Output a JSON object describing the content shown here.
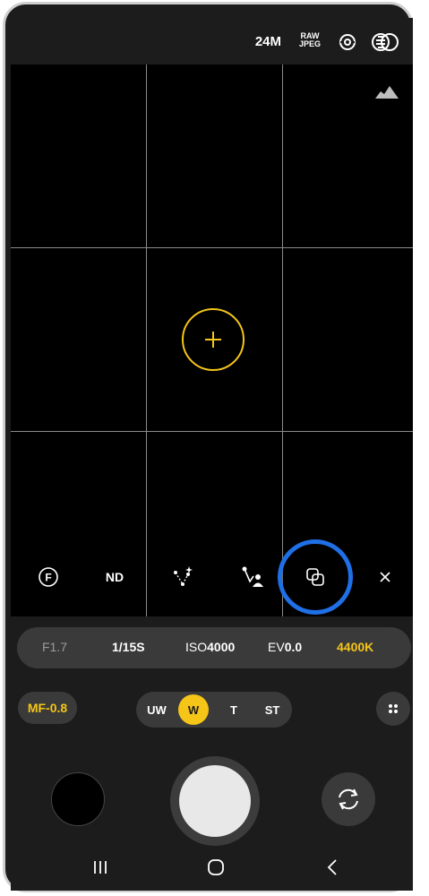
{
  "status_bar": {
    "resolution_label": "24M",
    "format_label_top": "RAW",
    "format_label_bottom": "JPEG",
    "icons": [
      "focus-ring-icon",
      "overlap-circles-icon"
    ]
  },
  "viewfinder": {
    "histogram_icon": "mountain-icon",
    "focus_point": "plus-target"
  },
  "tools": [
    {
      "name": "f-icon"
    },
    {
      "name": "nd-filter",
      "label": "ND"
    },
    {
      "name": "astro-icon"
    },
    {
      "name": "curve-person-icon"
    },
    {
      "name": "multi-exposure-icon"
    },
    {
      "name": "close-icon"
    }
  ],
  "params": {
    "aperture": "F1.7",
    "shutter": "1/15S",
    "iso_label": "ISO",
    "iso_value": "4000",
    "ev_label": "EV",
    "ev_value": "0.0",
    "white_balance": "4400K"
  },
  "focus_mode": "MF-0.8",
  "lenses": [
    "UW",
    "W",
    "T",
    "ST"
  ],
  "active_lens": "W",
  "colors": {
    "accent": "#f5c518",
    "highlight": "#1f6fe6",
    "panel": "#3a3a3a"
  }
}
